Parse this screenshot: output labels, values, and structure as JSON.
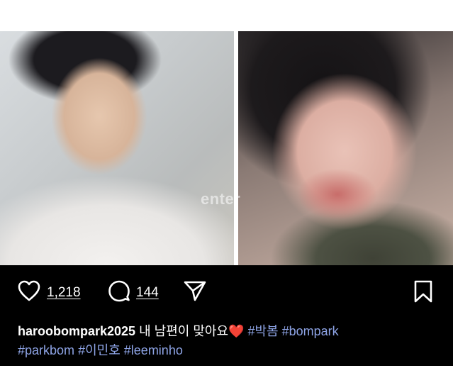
{
  "image": {
    "watermark": "enter"
  },
  "actions": {
    "likes": "1,218",
    "comments": "144"
  },
  "caption": {
    "username": "haroobompark2025",
    "text": "내 남편이 맞아요",
    "emoji": "❤️",
    "hashtags": [
      "#박봄",
      "#bompark",
      "#parkbom",
      "#이민호",
      "#leeminho"
    ]
  },
  "icons": {
    "like": "heart-icon",
    "comment": "comment-icon",
    "share": "send-icon",
    "save": "bookmark-icon"
  },
  "colors": {
    "background": "#000000",
    "text": "#ffffff",
    "hashtag": "#8ea4e6",
    "heart_emoji": "#e8232c"
  }
}
